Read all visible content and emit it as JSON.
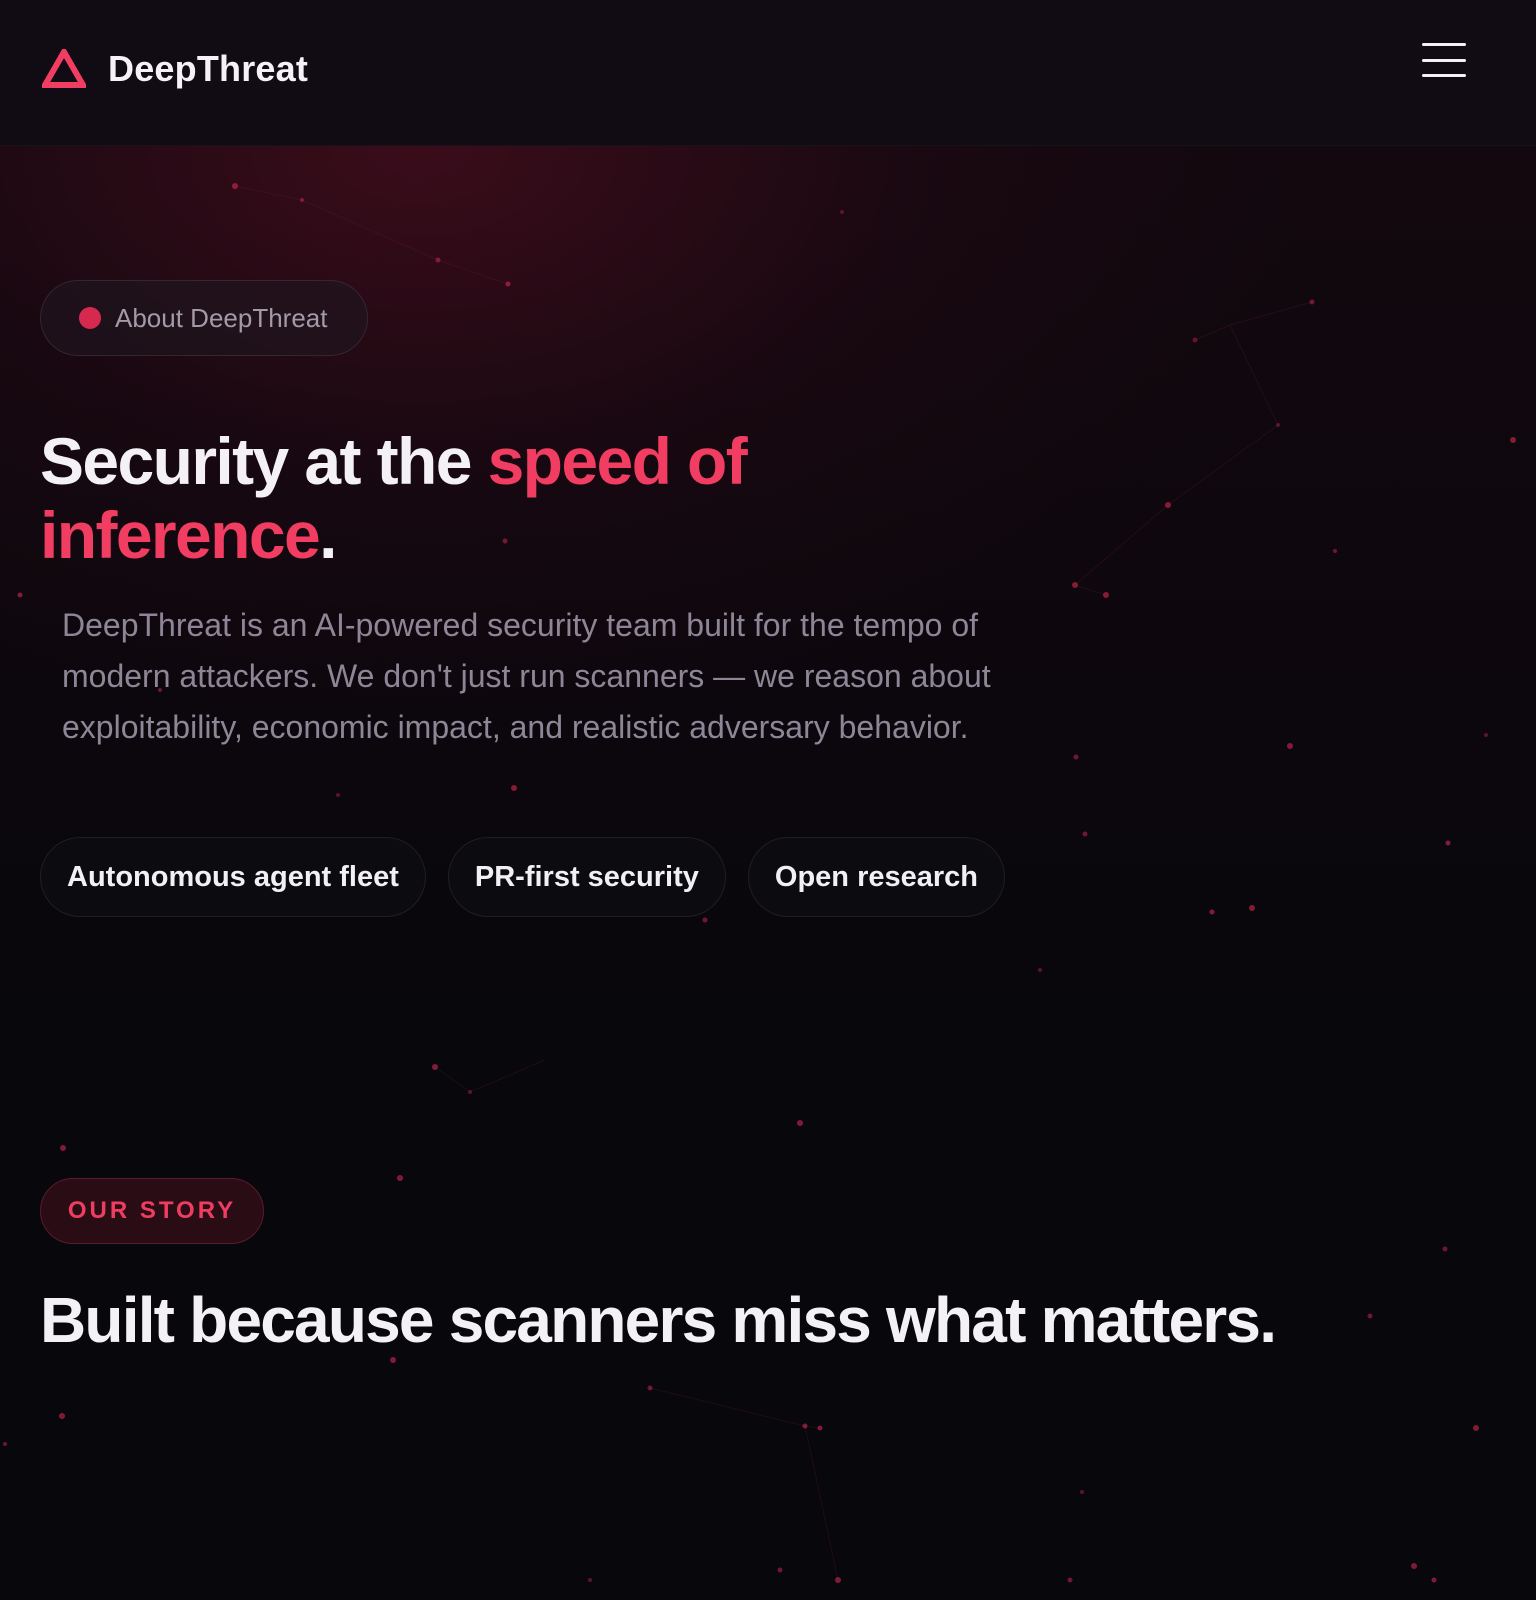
{
  "header": {
    "brand_name": "DeepThreat",
    "logo_icon": "triangle-logo-icon",
    "menu_icon": "hamburger-menu-icon"
  },
  "hero": {
    "badge_text": "About DeepThreat",
    "title_part1": "Security at the ",
    "title_accent": "speed of inference",
    "title_end": ".",
    "description": "DeepThreat is an AI-powered security team built for the tempo of modern attackers. We don't just run scanners — we reason about exploitability, economic impact, and realistic adversary behavior.",
    "chips": [
      "Autonomous agent fleet",
      "PR-first security",
      "Open research"
    ]
  },
  "story": {
    "label": "OUR STORY",
    "title": "Built because scanners miss what matters."
  },
  "colors": {
    "accent": "#f23d63",
    "background": "#07070c",
    "header_background": "#110b13",
    "text_primary": "#f3f1f5",
    "text_muted": "#8d8696"
  }
}
